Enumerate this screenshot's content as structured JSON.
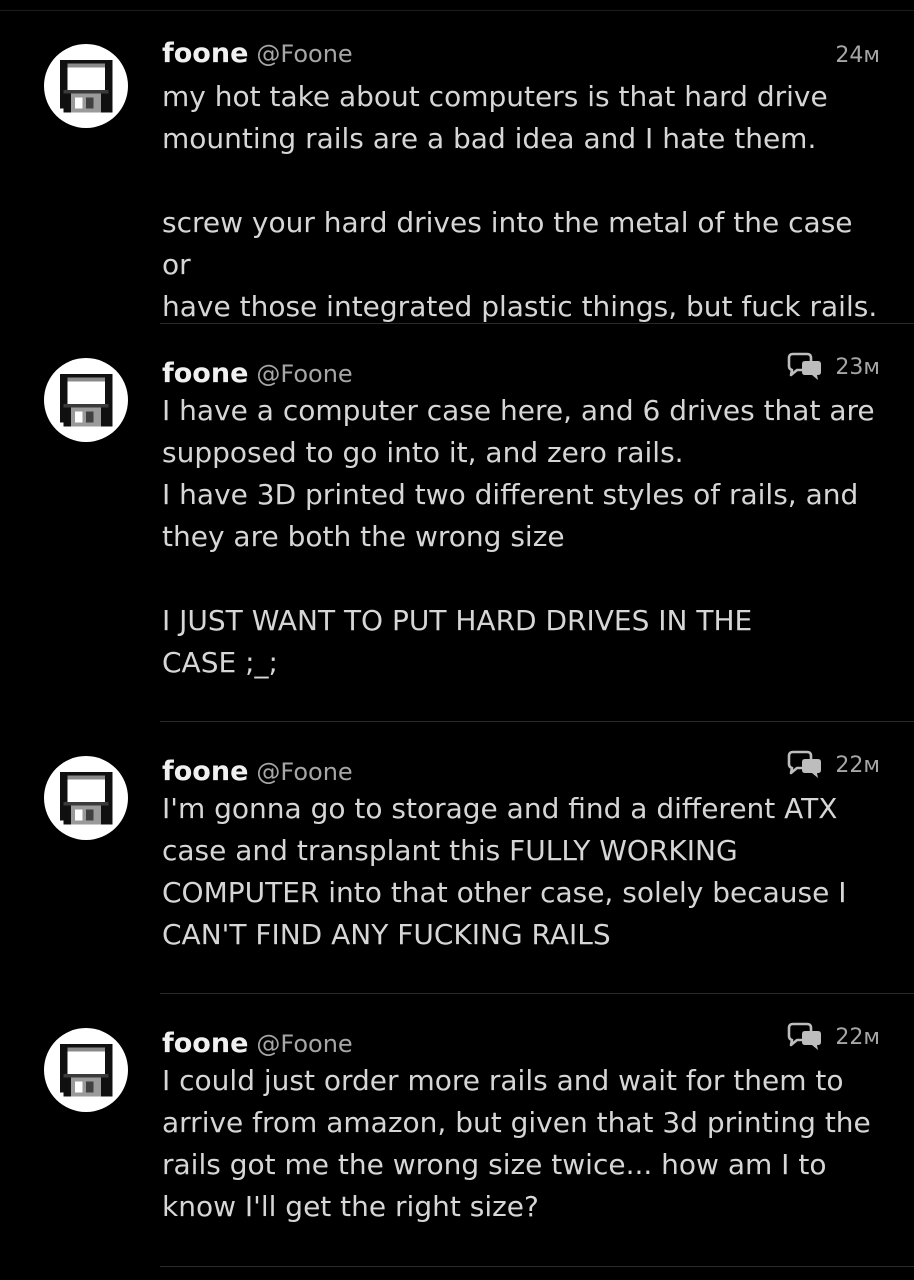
{
  "tweets": [
    {
      "name": "foone",
      "handle": "@Foone",
      "time": "24м",
      "has_reply_icon": false,
      "text": "my hot take about computers is that hard drive\nmounting rails are a bad idea and I hate them.\n\nscrew your hard drives into the metal of the case or\nhave those integrated plastic things, but fuck rails."
    },
    {
      "name": "foone",
      "handle": "@Foone",
      "time": "23м",
      "has_reply_icon": true,
      "text": "I have a computer case here, and 6 drives that are\nsupposed to go into it, and zero rails.\nI have 3D printed two different styles of rails, and\nthey are both the wrong size\n\nI JUST WANT TO PUT HARD DRIVES IN THE\nCASE ;_;"
    },
    {
      "name": "foone",
      "handle": "@Foone",
      "time": "22м",
      "has_reply_icon": true,
      "text": "I'm gonna go to storage and find a different ATX\ncase and transplant this FULLY WORKING\nCOMPUTER into that other case, solely because I\nCAN'T FIND ANY FUCKING RAILS"
    },
    {
      "name": "foone",
      "handle": "@Foone",
      "time": "22м",
      "has_reply_icon": true,
      "text": "I could just order more rails and wait for them to\narrive from amazon, but given that 3d printing the\nrails got me the wrong size twice... how am I to\nknow I'll get the right size?"
    }
  ],
  "icons": {
    "avatar": "floppy-disk-icon",
    "reply": "conversation-icon"
  },
  "colors": {
    "background": "#000000",
    "name": "#f0f0f0",
    "text": "#d6d6d6",
    "secondary": "#a6a6a6",
    "divider": "#2a2a2a"
  }
}
